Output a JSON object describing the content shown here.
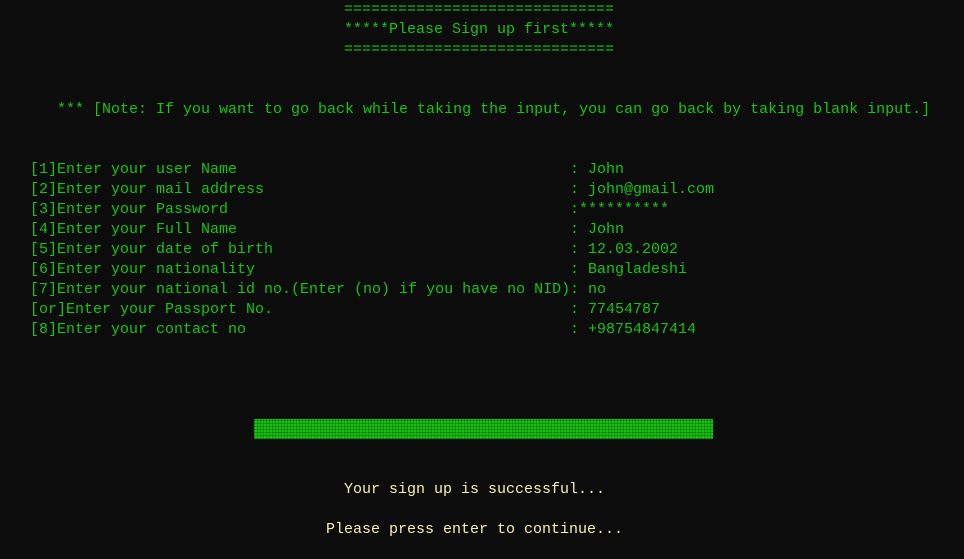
{
  "header": {
    "rule_top": "==============================",
    "title": "*****Please Sign up first*****",
    "rule_bottom": "=============================="
  },
  "note": "*** [Note: If you want to go back while taking the input, you can go back by taking blank input.]",
  "fields": [
    {
      "label": "[1]Enter your user Name",
      "sep": ": ",
      "value": "John"
    },
    {
      "label": "[2]Enter your mail address",
      "sep": ": ",
      "value": "john@gmail.com"
    },
    {
      "label": "[3]Enter your Password",
      "sep": ":",
      "value": "**********"
    },
    {
      "label": "[4]Enter your Full Name",
      "sep": ": ",
      "value": "John"
    },
    {
      "label": "[5]Enter your date of birth",
      "sep": ": ",
      "value": "12.03.2002"
    },
    {
      "label": "[6]Enter your nationality",
      "sep": ": ",
      "value": "Bangladeshi"
    },
    {
      "label": "[7]Enter your national id no.(Enter (no) if you have no NID)",
      "sep": ": ",
      "value": "no"
    },
    {
      "label": "[or]Enter your Passport No.",
      "sep": ": ",
      "value": "77454787"
    },
    {
      "label": "[8]Enter your contact no",
      "sep": ": ",
      "value": "+98754847414"
    }
  ],
  "progress": {
    "percent": 100
  },
  "status": {
    "success": "Your sign up is successful...",
    "continue": "Please press enter to continue..."
  },
  "colors": {
    "text": "#16c60c",
    "status": "#f9f1a5",
    "background": "#0c0c0c"
  }
}
